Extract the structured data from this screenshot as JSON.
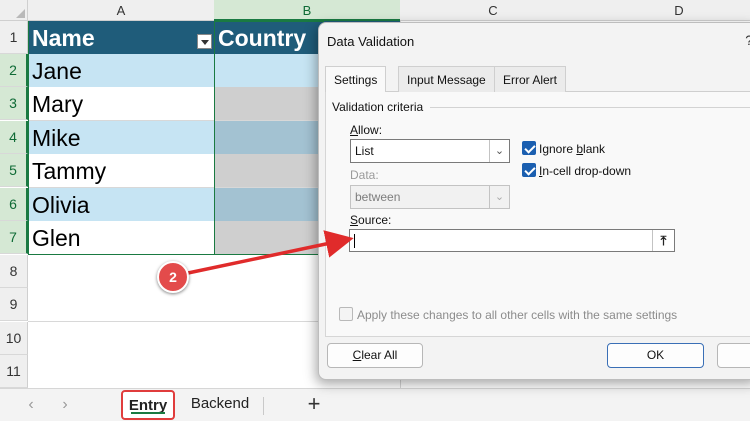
{
  "sheet": {
    "columns": [
      "A",
      "B",
      "C",
      "D"
    ],
    "rows": [
      "1",
      "2",
      "3",
      "4",
      "5",
      "6",
      "7",
      "8",
      "9",
      "10",
      "11"
    ],
    "headers": {
      "name": "Name",
      "country": "Country"
    },
    "names": [
      "Jane",
      "Mary",
      "Mike",
      "Tammy",
      "Olivia",
      "Glen"
    ]
  },
  "tabbar": {
    "prev": "‹",
    "next": "›",
    "tabs": [
      "Entry",
      "Backend"
    ],
    "add": "+"
  },
  "dialog": {
    "title": "Data Validation",
    "help": "?",
    "tabs": [
      "Settings",
      "Input Message",
      "Error Alert"
    ],
    "group_label": "Validation criteria",
    "allow_label": "Allow:",
    "allow_value": "List",
    "data_label": "Data:",
    "data_value": "between",
    "ignore_blank_label": "Ignore blank",
    "ignore_blank_checked": true,
    "in_cell_dropdown_label": "In-cell drop-down",
    "in_cell_dropdown_checked": true,
    "source_label": "Source:",
    "source_value": "",
    "apply_all_label": "Apply these changes to all other cells with the same settings",
    "apply_all_checked": false,
    "clear_all_label": "Clear All",
    "ok_label": "OK"
  },
  "callout": {
    "number": "2"
  },
  "colors": {
    "header_fill": "#1f5c7a",
    "band_fill": "#c6e4f3",
    "excel_green": "#1a7a42",
    "callout_red": "#e34b4b",
    "checkbox_blue": "#1b5fb0"
  },
  "icons": [
    "filter-dropdown-icon",
    "chevron-down-icon",
    "collapse-dialog-icon",
    "checkmark-icon",
    "arrow-annotation"
  ]
}
